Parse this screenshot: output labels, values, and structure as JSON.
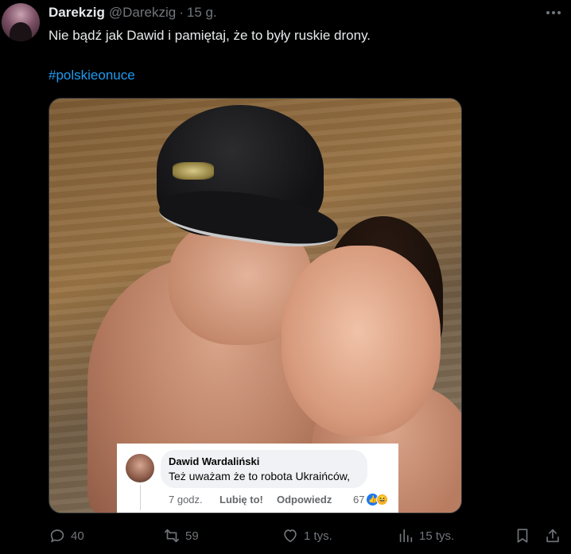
{
  "tweet": {
    "author_name": "Darekzig",
    "author_handle": "@Darekzig",
    "separator": "·",
    "time": "15 g.",
    "text": "Nie bądź jak Dawid i pamiętaj, że to były ruskie drony.",
    "hashtag": "#polskieonuce"
  },
  "embedded_comment": {
    "author": "Dawid Wardaliński",
    "text": "Też uważam że to robota Ukraińców,",
    "time": "7 godz.",
    "like_label": "Lubię to!",
    "reply_label": "Odpowiedz",
    "reaction_count": "67"
  },
  "actions": {
    "replies": "40",
    "reposts": "59",
    "likes": "1 tys.",
    "views": "15 tys."
  },
  "colors": {
    "background": "#000000",
    "text_primary": "#e7e9ea",
    "text_secondary": "#71767b",
    "accent": "#1d9bf0"
  },
  "icons": {
    "more": "more-horizontal-icon",
    "reply": "reply-icon",
    "repost": "repost-icon",
    "like": "heart-icon",
    "views": "views-chart-icon",
    "bookmark": "bookmark-icon",
    "share": "share-icon"
  }
}
